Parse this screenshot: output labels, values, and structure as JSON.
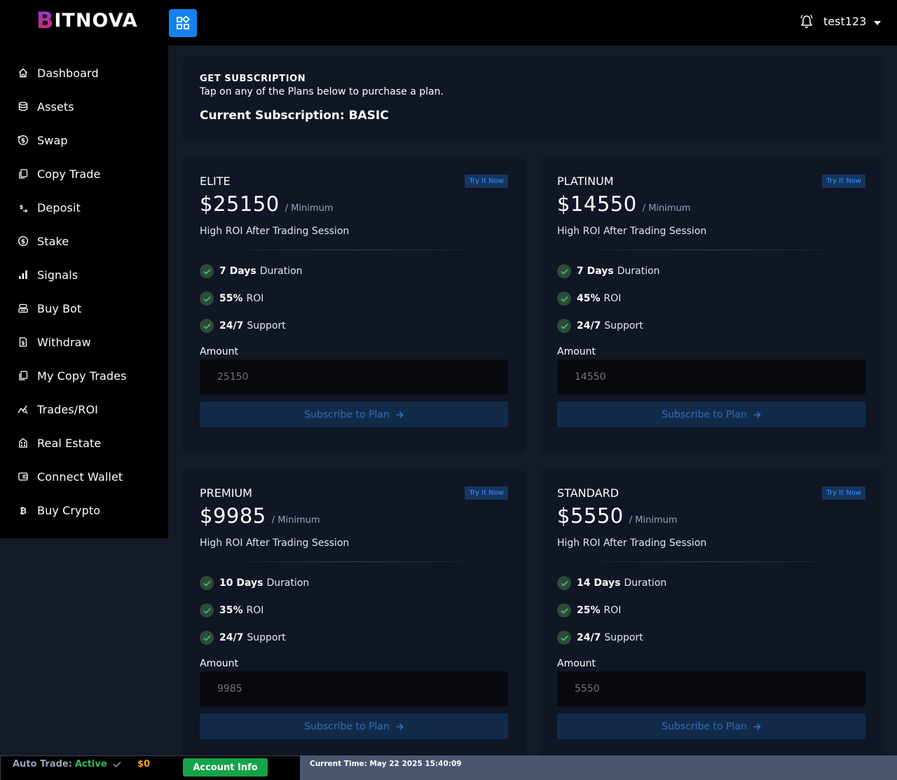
{
  "brand": {
    "logo_first": "B",
    "logo_rest": "ITNOVA"
  },
  "header": {
    "username": "test123"
  },
  "sidebar": {
    "items": [
      {
        "label": "Dashboard",
        "icon": "home-icon"
      },
      {
        "label": "Assets",
        "icon": "database-icon"
      },
      {
        "label": "Swap",
        "icon": "swap-icon"
      },
      {
        "label": "Copy Trade",
        "icon": "copy-icon"
      },
      {
        "label": "Deposit",
        "icon": "deposit-icon"
      },
      {
        "label": "Stake",
        "icon": "dollar-circle-icon"
      },
      {
        "label": "Signals",
        "icon": "signal-bars-icon"
      },
      {
        "label": "Buy Bot",
        "icon": "bot-icon"
      },
      {
        "label": "Withdraw",
        "icon": "withdraw-icon"
      },
      {
        "label": "My Copy Trades",
        "icon": "copy-icon"
      },
      {
        "label": "Trades/ROI",
        "icon": "chart-line-icon"
      },
      {
        "label": "Real Estate",
        "icon": "building-icon"
      },
      {
        "label": "Connect Wallet",
        "icon": "wallet-icon"
      },
      {
        "label": "Buy Crypto",
        "icon": "bitcoin-icon"
      }
    ]
  },
  "subscription": {
    "eyebrow": "GET SUBSCRIPTION",
    "description": "Tap on any of the Plans below to purchase a plan.",
    "current": "Current Subscription: BASIC"
  },
  "plans": [
    {
      "name": "ELITE",
      "badge": "Try It Now",
      "price": "$25150",
      "price_suffix": "/ Minimum",
      "description": "High ROI After Trading Session",
      "features": [
        {
          "strong": "7 Days",
          "text": "Duration"
        },
        {
          "strong": "55%",
          "text": "ROI"
        },
        {
          "strong": "24/7",
          "text": "Support"
        }
      ],
      "amount_label": "Amount",
      "amount_placeholder": "25150",
      "button": "Subscribe to Plan"
    },
    {
      "name": "PLATINUM",
      "badge": "Try It Now",
      "price": "$14550",
      "price_suffix": "/ Minimum",
      "description": "High ROI After Trading Session",
      "features": [
        {
          "strong": "7 Days",
          "text": "Duration"
        },
        {
          "strong": "45%",
          "text": "ROI"
        },
        {
          "strong": "24/7",
          "text": "Support"
        }
      ],
      "amount_label": "Amount",
      "amount_placeholder": "14550",
      "button": "Subscribe to Plan"
    },
    {
      "name": "PREMIUM",
      "badge": "Try It Now",
      "price": "$9985",
      "price_suffix": "/ Minimum",
      "description": "High ROI After Trading Session",
      "features": [
        {
          "strong": "10 Days",
          "text": "Duration"
        },
        {
          "strong": "35%",
          "text": "ROI"
        },
        {
          "strong": "24/7",
          "text": "Support"
        }
      ],
      "amount_label": "Amount",
      "amount_placeholder": "9985",
      "button": "Subscribe to Plan"
    },
    {
      "name": "STANDARD",
      "badge": "Try It Now",
      "price": "$5550",
      "price_suffix": "/ Minimum",
      "description": "High ROI After Trading Session",
      "features": [
        {
          "strong": "14 Days",
          "text": "Duration"
        },
        {
          "strong": "25%",
          "text": "ROI"
        },
        {
          "strong": "24/7",
          "text": "Support"
        }
      ],
      "amount_label": "Amount",
      "amount_placeholder": "5550",
      "button": "Subscribe to Plan"
    }
  ],
  "footer": {
    "auto_trade_label": "Auto Trade:",
    "auto_trade_status": "Active",
    "balance": "$0",
    "account_button": "Account Info",
    "current_time": "Current Time: May 22 2025 15:40:09"
  },
  "colors": {
    "accent": "#1482f0",
    "success": "#16a34a",
    "active": "#2fbf5a",
    "balance": "#f0a020",
    "card": "#101624",
    "background": "#141a27"
  }
}
